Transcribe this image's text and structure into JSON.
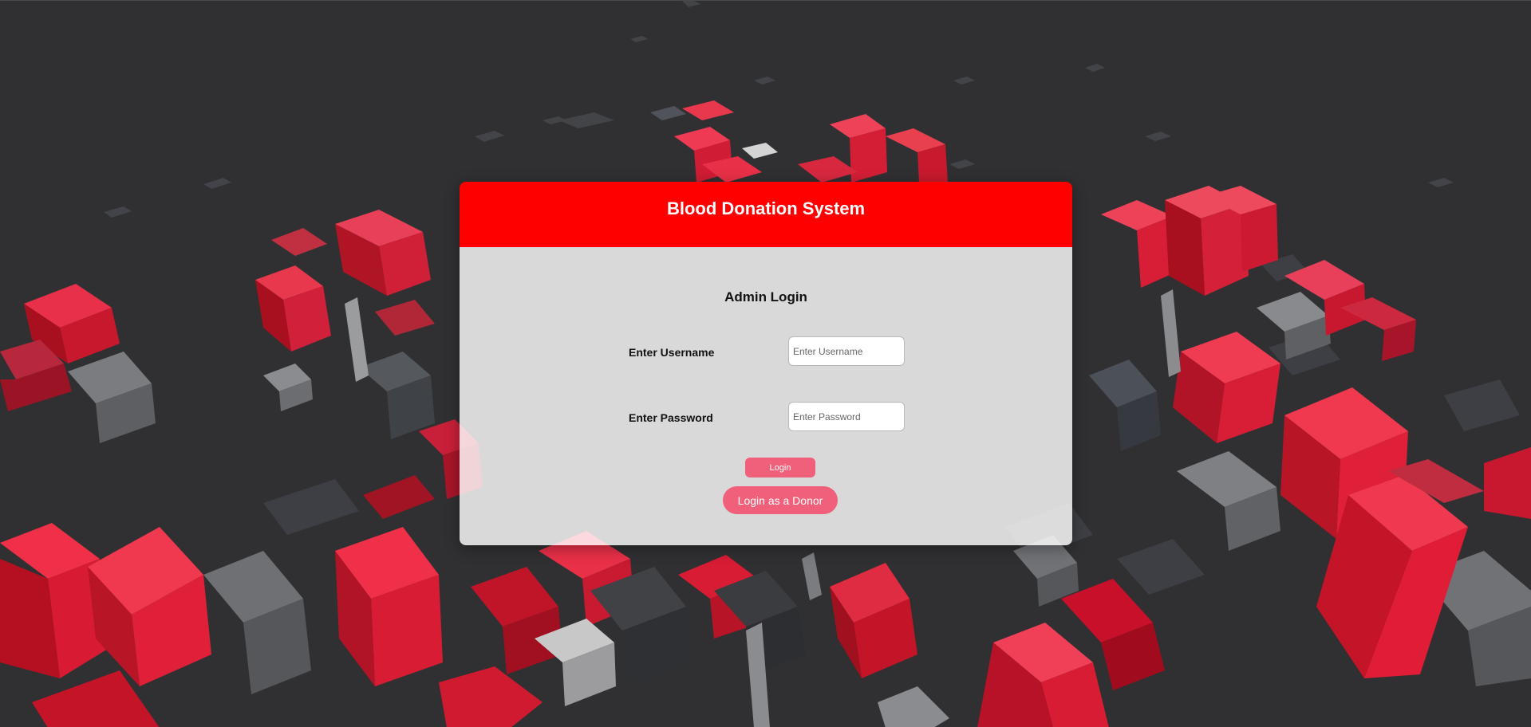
{
  "header": {
    "title": "Blood Donation System"
  },
  "form": {
    "heading": "Admin Login",
    "username": {
      "label": "Enter Username",
      "placeholder": "Enter Username",
      "value": ""
    },
    "password": {
      "label": "Enter Password",
      "placeholder": "Enter Password",
      "value": ""
    },
    "login_label": "Login",
    "donor_login_label": "Login as a Donor"
  },
  "colors": {
    "header": "#ff0000",
    "button": "#f0607a",
    "background": "#303032",
    "card_body": "rgba(255,255,255,0.82)"
  }
}
